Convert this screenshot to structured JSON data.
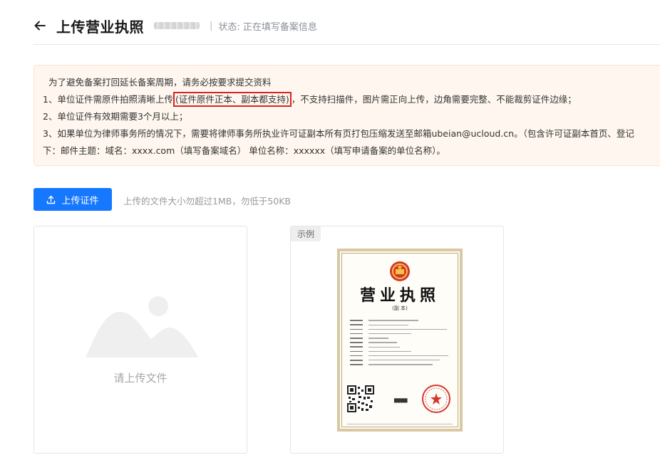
{
  "header": {
    "title": "上传营业执照",
    "separator": "|",
    "status": "状态: 正在填写备案信息"
  },
  "notice": {
    "intro": "为了避免备案打回延长备案周期，请务必按要求提交资料",
    "item1_before": "1、单位证件需原件拍照清晰上传",
    "item1_highlight": "(证件原件正本、副本都支持)",
    "item1_after": "，不支持扫描件，图片需正向上传，边角需要完整、不能裁剪证件边缘；",
    "item2": "2、单位证件有效期需要3个月以上；",
    "item3": "3、如果单位为律师事务所的情况下，需要将律师事务所执业许可证副本所有页打包压缩发送至邮箱ubeian@ucloud.cn。（包含许可证副本首页、登记",
    "item3_cont": "下：邮件主题：域名：xxxx.com（填写备案域名） 单位名称：xxxxxx（填写申请备案的单位名称）。",
    "highlight_color": "#d9231d"
  },
  "upload": {
    "button_label": "上传证件",
    "hint": "上传的文件大小勿超过1MB，勿低于50KB",
    "button_color": "#1677ff"
  },
  "upload_card": {
    "placeholder": "请上传文件"
  },
  "example_card": {
    "tag": "示例",
    "license_title": "营业执照",
    "license_subtitle": "(副 本)"
  }
}
